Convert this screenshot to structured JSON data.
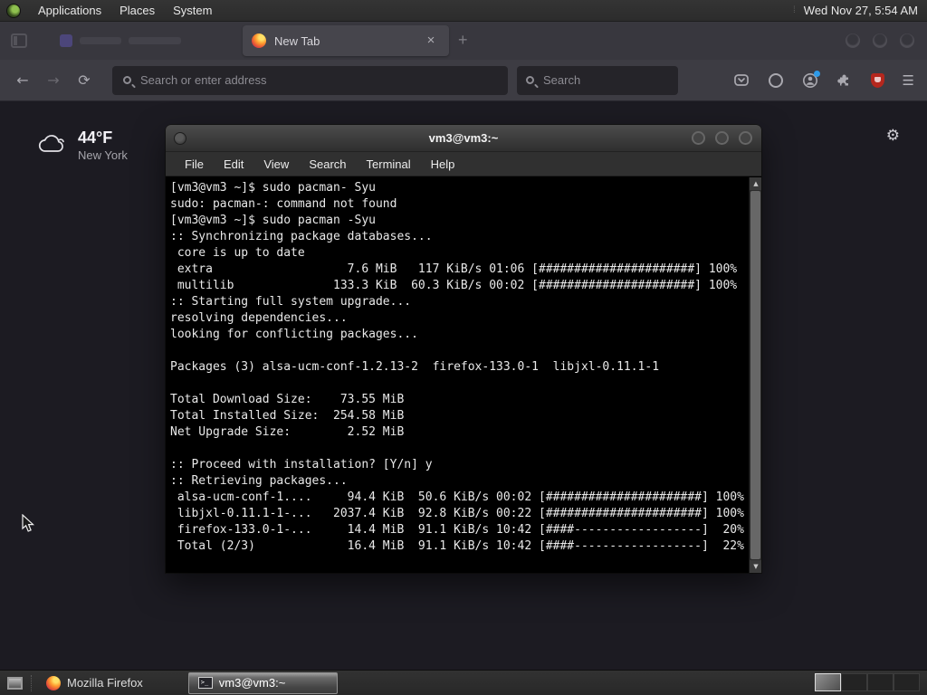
{
  "panel": {
    "menus": [
      {
        "label": "Applications"
      },
      {
        "label": "Places"
      },
      {
        "label": "System"
      }
    ],
    "clock": "Wed Nov 27, 5:54 AM"
  },
  "browser": {
    "active_tab_title": "New Tab",
    "close_glyph": "×",
    "new_tab_glyph": "+",
    "back_glyph": "←",
    "forward_glyph": "→",
    "reload_glyph": "⟳",
    "menu_glyph": "☰",
    "urlbar_placeholder": "Search or enter address",
    "search_placeholder": "Search",
    "settings_gear_glyph": "⚙",
    "weather": {
      "temperature": "44°F",
      "location": "New York"
    }
  },
  "terminal": {
    "title": "vm3@vm3:~",
    "menu": [
      "File",
      "Edit",
      "View",
      "Search",
      "Terminal",
      "Help"
    ],
    "scroll_up_glyph": "▲",
    "scroll_down_glyph": "▼",
    "lines": [
      "[vm3@vm3 ~]$ sudo pacman- Syu",
      "sudo: pacman-: command not found",
      "[vm3@vm3 ~]$ sudo pacman -Syu",
      ":: Synchronizing package databases...",
      " core is up to date",
      " extra                   7.6 MiB   117 KiB/s 01:06 [######################] 100%",
      " multilib              133.3 KiB  60.3 KiB/s 00:02 [######################] 100%",
      ":: Starting full system upgrade...",
      "resolving dependencies...",
      "looking for conflicting packages...",
      "",
      "Packages (3) alsa-ucm-conf-1.2.13-2  firefox-133.0-1  libjxl-0.11.1-1",
      "",
      "Total Download Size:    73.55 MiB",
      "Total Installed Size:  254.58 MiB",
      "Net Upgrade Size:        2.52 MiB",
      "",
      ":: Proceed with installation? [Y/n] y",
      ":: Retrieving packages...",
      " alsa-ucm-conf-1....     94.4 KiB  50.6 KiB/s 00:02 [######################] 100%",
      " libjxl-0.11.1-1-...   2037.4 KiB  92.8 KiB/s 00:22 [######################] 100%",
      " firefox-133.0-1-...     14.4 MiB  91.1 KiB/s 10:42 [####------------------]  20%",
      " Total (2/3)             16.4 MiB  91.1 KiB/s 10:42 [####------------------]  22%"
    ]
  },
  "taskbar": {
    "firefox_label": "Mozilla Firefox",
    "terminal_label": "vm3@vm3:~"
  },
  "colors": {
    "notification_blue": "#2e9ae8",
    "ublock_red": "#b5271d"
  }
}
